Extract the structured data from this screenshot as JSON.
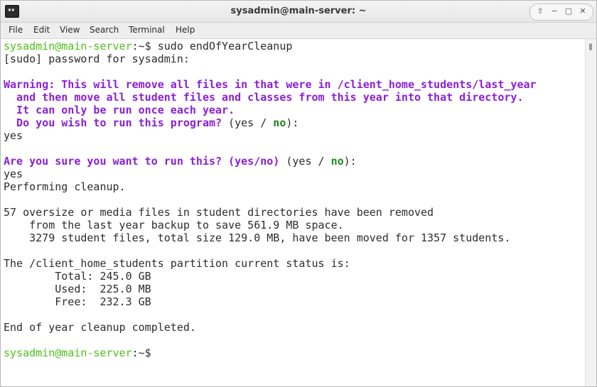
{
  "window": {
    "title": "sysadmin@main-server: ~",
    "controls": [
      "⇧",
      "−",
      "▢",
      "✕"
    ]
  },
  "app_icon_glyph": "▪▪",
  "menu": [
    "File",
    "Edit",
    "View",
    "Search",
    "Terminal",
    "Help"
  ],
  "terminal": {
    "l1": {
      "user": "sysadmin@main-server",
      "path": ":~$",
      "cmd": " sudo endOfYearCleanup"
    },
    "l2": "[sudo] password for sysadmin:",
    "l4": "Warning: This will remove all files in that were in /client_home_students/last_year",
    "l5": "  and then move all student files and classes from this year into that directory.",
    "l6": "  It can only be run once each year.",
    "l7": {
      "q": "  Do you wish to run this program?",
      "open": " (yes / ",
      "no": "no",
      "close": "):"
    },
    "l8": "yes",
    "l10": {
      "q": "Are you sure you want to run this? (yes/no)",
      "open": " (yes / ",
      "no": "no",
      "close": "):"
    },
    "l11": "yes",
    "l12": "Performing cleanup.",
    "l14": "57 oversize or media files in student directories have been removed",
    "l15": "    from the last year backup to save 561.9 MB space.",
    "l16": "    3279 student files, total size 129.0 MB, have been moved for 1357 students.",
    "l18": "The /client_home_students partition current status is:",
    "l19": "        Total: 245.0 GB",
    "l20": "        Used:  225.0 MB",
    "l21": "        Free:  232.3 GB",
    "l23": "End of year cleanup completed.",
    "l25": {
      "user": "sysadmin@main-server",
      "path": ":~$"
    }
  },
  "colors": {
    "prompt_green": "#4fbf1a",
    "warning_purple": "#8a1fd8",
    "default_no_green": "#1f8a1f"
  }
}
